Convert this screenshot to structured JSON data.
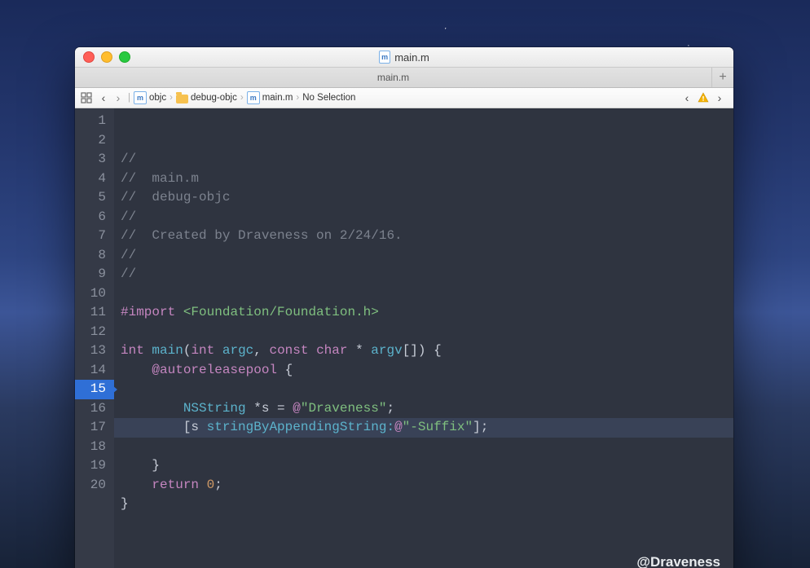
{
  "window": {
    "title": "main.m",
    "doc_icon_letter": "m"
  },
  "tabs": {
    "items": [
      {
        "label": "main.m"
      }
    ]
  },
  "jumpbar": {
    "back_enabled": true,
    "forward_enabled": false,
    "path": [
      {
        "icon": "file-m",
        "label": "objc"
      },
      {
        "icon": "folder",
        "label": "debug-objc"
      },
      {
        "icon": "file-m",
        "label": "main.m"
      },
      {
        "icon": "",
        "label": "No Selection"
      }
    ],
    "issues_back_enabled": true,
    "issues_forward_enabled": true,
    "warning_count": 1
  },
  "code": {
    "file": "main.m",
    "project": "debug-objc",
    "author": "Draveness",
    "created": "2/24/16",
    "watermark": "@Draveness",
    "highlighted_line": 15,
    "lines": [
      {
        "n": 1,
        "kind": "comment",
        "text": "//"
      },
      {
        "n": 2,
        "kind": "comment",
        "text": "//  main.m"
      },
      {
        "n": 3,
        "kind": "comment",
        "text": "//  debug-objc"
      },
      {
        "n": 4,
        "kind": "comment",
        "text": "//"
      },
      {
        "n": 5,
        "kind": "comment",
        "text": "//  Created by Draveness on 2/24/16."
      },
      {
        "n": 6,
        "kind": "comment",
        "text": "//"
      },
      {
        "n": 7,
        "kind": "comment",
        "text": "//"
      },
      {
        "n": 8,
        "kind": "blank",
        "text": ""
      },
      {
        "n": 9,
        "kind": "import",
        "pp": "#import",
        "angle": "<Foundation/Foundation.h>"
      },
      {
        "n": 10,
        "kind": "blank",
        "text": ""
      },
      {
        "n": 11,
        "kind": "sig",
        "t1": "int",
        "f": "main",
        "t2": "int",
        "a1": "argc",
        "t3": "const char",
        "a2": "argv",
        "tail": "[]) {"
      },
      {
        "n": 12,
        "kind": "autorel",
        "indent": "    ",
        "kw": "@autoreleasepool",
        "tail": " {"
      },
      {
        "n": 13,
        "kind": "blank",
        "text": ""
      },
      {
        "n": 14,
        "kind": "decl",
        "indent": "        ",
        "cls": "NSString",
        "mid": " *s = ",
        "at": "@",
        "str": "\"Draveness\"",
        "tail": ";"
      },
      {
        "n": 15,
        "kind": "msg",
        "indent": "        ",
        "open": "[s ",
        "sel": "stringByAppendingString:",
        "at": "@",
        "str": "\"-Suffix\"",
        "tail": "];"
      },
      {
        "n": 16,
        "kind": "blank",
        "text": ""
      },
      {
        "n": 17,
        "kind": "plain",
        "text": "    }"
      },
      {
        "n": 18,
        "kind": "return",
        "indent": "    ",
        "kw": "return",
        "val": " 0",
        "tail": ";"
      },
      {
        "n": 19,
        "kind": "plain",
        "text": "}"
      },
      {
        "n": 20,
        "kind": "blank",
        "text": ""
      }
    ]
  }
}
